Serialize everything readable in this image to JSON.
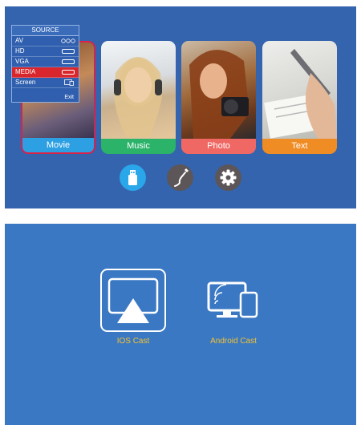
{
  "source_menu": {
    "title": "SOURCE",
    "items": [
      {
        "label": "AV"
      },
      {
        "label": "HD"
      },
      {
        "label": "VGA"
      },
      {
        "label": "MEDIA",
        "selected": true
      },
      {
        "label": "Screen"
      }
    ],
    "exit_label": "Exit"
  },
  "media_cards": [
    {
      "label": "Movie",
      "color": "#2d9fe3"
    },
    {
      "label": "Music",
      "color": "#2bb36a"
    },
    {
      "label": "Photo",
      "color": "#f06864"
    },
    {
      "label": "Text",
      "color": "#f08c24"
    }
  ],
  "bottom_buttons": [
    {
      "icon": "usb-icon",
      "color": "#2aa6ea"
    },
    {
      "icon": "cable-icon",
      "color": "#5c5658"
    },
    {
      "icon": "gear-icon",
      "color": "#5c5658"
    }
  ],
  "cast": {
    "ios_label": "IOS Cast",
    "android_label": "Android Cast"
  },
  "colors": {
    "top_screen_bg": "#3564ae",
    "bottom_screen_bg": "#3a78c3",
    "selected_row": "#d8262c",
    "cast_label": "#f4c232"
  }
}
